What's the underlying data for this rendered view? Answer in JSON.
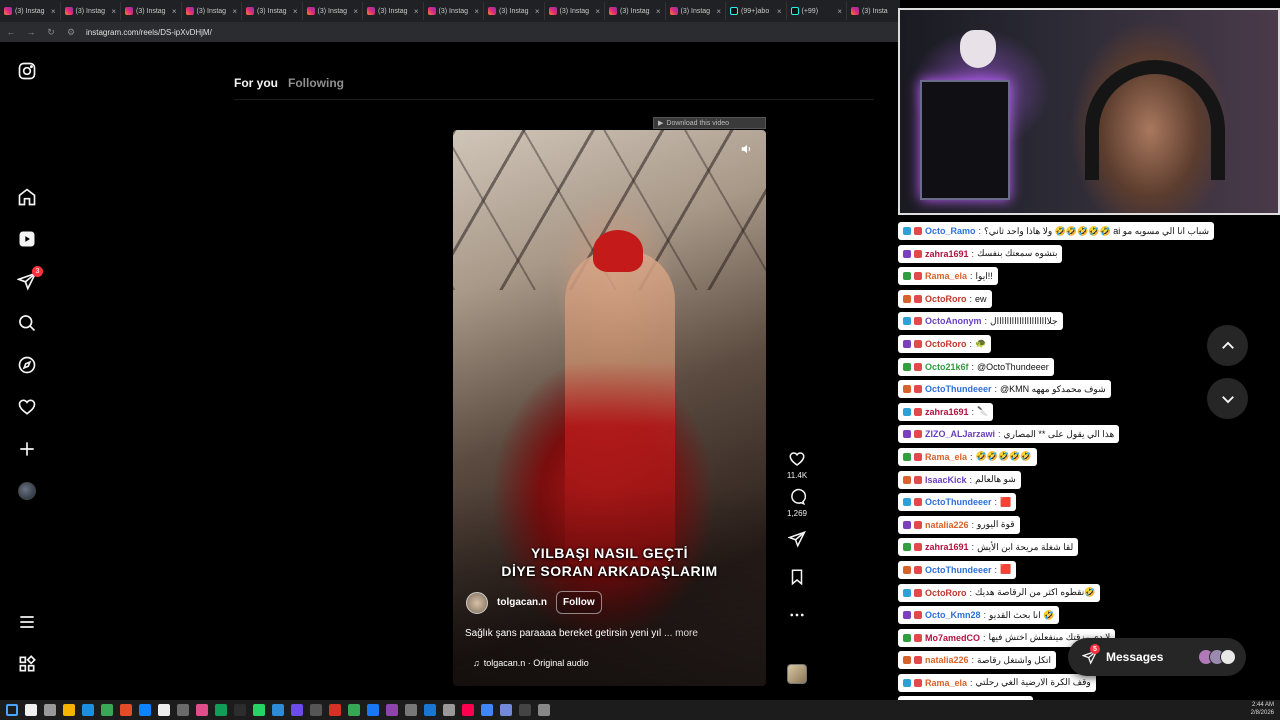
{
  "browser": {
    "tabs": [
      {
        "label": "(3) Instag",
        "icon": "instagram"
      },
      {
        "label": "(3) Instag",
        "icon": "instagram"
      },
      {
        "label": "(3) Instag",
        "icon": "instagram"
      },
      {
        "label": "(3) Instag",
        "icon": "instagram"
      },
      {
        "label": "(3) Instag",
        "icon": "instagram"
      },
      {
        "label": "(3) Instag",
        "icon": "instagram"
      },
      {
        "label": "(3) Instag",
        "icon": "instagram"
      },
      {
        "label": "(3) Instag",
        "icon": "instagram"
      },
      {
        "label": "(3) Instag",
        "icon": "instagram"
      },
      {
        "label": "(3) Instag",
        "icon": "instagram"
      },
      {
        "label": "(3) Instag",
        "icon": "instagram"
      },
      {
        "label": "(3) Instag",
        "icon": "instagram"
      },
      {
        "label": "(99+)abo",
        "icon": "tiktok"
      },
      {
        "label": "(+99)",
        "icon": "tiktok"
      },
      {
        "label": "(3) Insta",
        "icon": "instagram"
      }
    ],
    "url": "instagram.com/reels/DS-ipXvDHjM/"
  },
  "sidebar": {
    "items": [
      {
        "name": "instagram-logo-icon"
      },
      {
        "name": "home-icon"
      },
      {
        "name": "reels-icon"
      },
      {
        "name": "messages-icon",
        "badge": "3"
      },
      {
        "name": "search-icon"
      },
      {
        "name": "explore-icon"
      },
      {
        "name": "notifications-icon"
      },
      {
        "name": "create-icon"
      },
      {
        "name": "profile-avatar"
      },
      {
        "name": "more-menu-icon"
      },
      {
        "name": "also-from-meta-icon"
      }
    ]
  },
  "feed_tabs": {
    "for_you": "For you",
    "following": "Following"
  },
  "reel": {
    "download_banner": "Download this video",
    "caption_line1": "YILBAŞI NASIL GEÇTİ",
    "caption_line2": "DİYE SORAN ARKADAŞLARIM",
    "author": "tolgacan.n",
    "follow_label": "Follow",
    "description": "Sağlık şans paraaaa bereket getirsin yeni yıl",
    "more_label": "... more",
    "audio": "tolgacan.n · Original audio",
    "likes": "11.4K",
    "comments": "1,269"
  },
  "chat": [
    {
      "user": "Octo_Ramo",
      "color": "#2f6fdb",
      "text": "ولا هاذا واحد ثاني؟ 🤣🤣🤣🤣🤣 ai شباب انا الي مسويه مو"
    },
    {
      "user": "zahra1691",
      "color": "#b3123f",
      "text": "بتشوه سمعتك بنفسك"
    },
    {
      "user": "Rama_ela",
      "color": "#d9622b",
      "text": "ايوا!!"
    },
    {
      "user": "OctoRoro",
      "color": "#c0392b",
      "text": "ew"
    },
    {
      "user": "OctoAnonym",
      "color": "#6a3fbf",
      "text": "جلااااااااااااااااااااال"
    },
    {
      "user": "OctoRoro",
      "color": "#c0392b",
      "text": "🐢"
    },
    {
      "user": "Octo21k6f",
      "color": "#2e9e3e",
      "text": "@OctoThundeeer"
    },
    {
      "user": "OctoThundeeer",
      "color": "#2f6fdb",
      "text": "@KMN شوف محمدكو مههه"
    },
    {
      "user": "zahra1691",
      "color": "#b3123f",
      "text": "🔪"
    },
    {
      "user": "ZIZO_ALJarzawi",
      "color": "#6a3fbf",
      "text": "هذا الي يقول على ** المصاري"
    },
    {
      "user": "Rama_ela",
      "color": "#d9622b",
      "text": "🤣🤣🤣🤣🤣"
    },
    {
      "user": "IsaacKick",
      "color": "#6a3fbf",
      "text": "شو هالعالم"
    },
    {
      "user": "OctoThundeeer",
      "color": "#2f6fdb",
      "text": "🟥"
    },
    {
      "user": "natalia226",
      "color": "#d9622b",
      "text": "قوة اليورو"
    },
    {
      "user": "zahra1691",
      "color": "#b3123f",
      "text": "لقا شغلة مريحة ابن الأيش"
    },
    {
      "user": "OctoThundeeer",
      "color": "#2f6fdb",
      "text": "🟥"
    },
    {
      "user": "OctoRoro",
      "color": "#c0392b",
      "text": "نقطوه اكثر من الرقاصة هديك🤣"
    },
    {
      "user": "Octo_Kmn28",
      "color": "#2f6fdb",
      "text": "انا بحث القديو 🤣"
    },
    {
      "user": "Mo7amedCO",
      "color": "#b3123f",
      "text": "لا دي رزقتك مينفعلش اختش فيها"
    },
    {
      "user": "natalia226",
      "color": "#d9622b",
      "text": "اتكل واشتغل رقاصة"
    },
    {
      "user": "Rama_ela",
      "color": "#d9622b",
      "text": "وقف الكرة الارضية الغي رحلتي"
    },
    {
      "user": "natalia226",
      "color": "#d9622b",
      "text": "عالوحده ونص"
    }
  ],
  "messages_pill": {
    "label": "Messages",
    "badge": "5"
  },
  "clock": {
    "time": "2:44 AM",
    "date": "2/8/2026"
  },
  "colors": {
    "instagram_red": "#ff3040",
    "feed_bg": "#000000",
    "pill_bg": "#262626"
  }
}
